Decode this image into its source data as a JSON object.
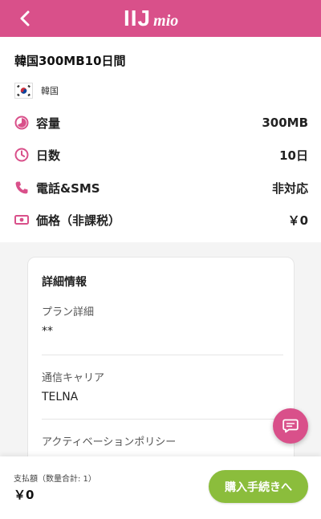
{
  "header": {
    "logo_main": "IIJ",
    "logo_sub": "mio",
    "back_icon": "chevron-left-icon",
    "color": "#d9508a"
  },
  "plan": {
    "title": "韓国300MB10日間",
    "country": "韓国",
    "flag_icon": "south-korea-flag-icon"
  },
  "specs": [
    {
      "icon": "pie-chart-icon",
      "label": "容量",
      "value": "300MB"
    },
    {
      "icon": "clock-icon",
      "label": "日数",
      "value": "10日"
    },
    {
      "icon": "phone-icon",
      "label": "電話&SMS",
      "value": "非対応"
    },
    {
      "icon": "banknote-icon",
      "label": "価格（非課税）",
      "value": "￥0"
    }
  ],
  "details": {
    "title": "詳細情報",
    "fields": [
      {
        "label": "プラン詳細",
        "value": "**"
      },
      {
        "label": "通信キャリア",
        "value": "TELNA"
      },
      {
        "label": "アクティベーションポリシー",
        "value": ""
      }
    ]
  },
  "chat": {
    "icon": "chat-icon"
  },
  "footer": {
    "pay_label": "支払額（数量合計: 1）",
    "pay_amount": "￥0",
    "buy_label": "購入手続きへ",
    "buy_color": "#8bbd3c"
  }
}
